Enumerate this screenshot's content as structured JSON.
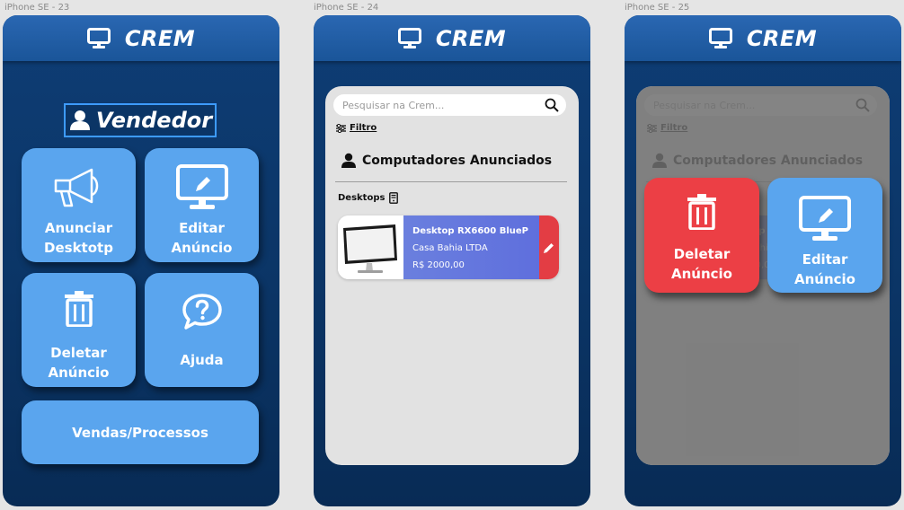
{
  "frames": [
    {
      "label": "iPhone SE - 23"
    },
    {
      "label": "iPhone SE - 24"
    },
    {
      "label": "iPhone SE - 25"
    }
  ],
  "app": {
    "title": "CREM"
  },
  "seller_menu": {
    "heading": "Vendedor",
    "tiles": [
      {
        "label": "Anunciar\nDesktotp",
        "icon": "megaphone-icon"
      },
      {
        "label": "Editar\nAnúncio",
        "icon": "monitor-edit-icon"
      },
      {
        "label": "Deletar\nAnúncio",
        "icon": "trash-icon"
      },
      {
        "label": "Ajuda",
        "icon": "help-bubble-icon"
      },
      {
        "label": "Vendas/Processos"
      }
    ]
  },
  "listings_screen": {
    "search_placeholder": "Pesquisar na Crem...",
    "filter_label": "Filtro",
    "section_title": "Computadores Anunciados",
    "category": "Desktops",
    "listing": {
      "name": "Desktop RX6600 BlueP",
      "seller": "Casa Bahia LTDA",
      "price": "R$ 2000,00"
    }
  },
  "action_popup": {
    "delete_label": "Deletar\nAnúncio",
    "edit_label": "Editar\nAnúncio"
  },
  "colors": {
    "phone_bg": "#0b3566",
    "topbar": "#1a5599",
    "tile": "#5aa5ee",
    "delete_red": "#ec3f45",
    "edit_blue": "#5aa5ee",
    "listing_purple": "#6a7fde"
  }
}
